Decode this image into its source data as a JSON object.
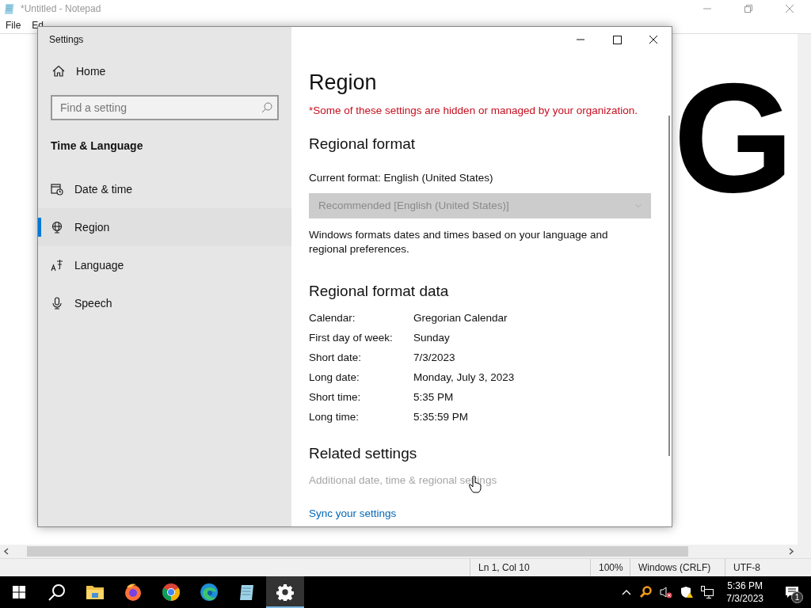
{
  "notepad": {
    "title": "*Untitled - Notepad",
    "menu": [
      "File",
      "Ed"
    ],
    "content": "G",
    "status": [
      "Ln 1, Col 10",
      "100%",
      "Windows (CRLF)",
      "UTF-8"
    ]
  },
  "settings": {
    "title": "Settings",
    "home": "Home",
    "search": {
      "placeholder": "Find a setting"
    },
    "section": "Time & Language",
    "nav": [
      {
        "kind": "calendar",
        "label": "Date & time",
        "selected": false
      },
      {
        "kind": "globe",
        "label": "Region",
        "selected": true
      },
      {
        "kind": "language",
        "label": "Language",
        "selected": false
      },
      {
        "kind": "mic",
        "label": "Speech",
        "selected": false
      }
    ],
    "page": {
      "title": "Region",
      "warning": "*Some of these settings are hidden or managed by your organization.",
      "format_heading": "Regional format",
      "current_format": "Current format: English (United States)",
      "dropdown": {
        "value": "Recommended [English (United States)]",
        "disabled": true
      },
      "description": "Windows formats dates and times based on your language and regional preferences.",
      "data_heading": "Regional format data",
      "data": [
        {
          "label": "Calendar:",
          "value": "Gregorian Calendar"
        },
        {
          "label": "First day of week:",
          "value": "Sunday"
        },
        {
          "label": "Short date:",
          "value": "7/3/2023"
        },
        {
          "label": "Long date:",
          "value": "Monday, July 3, 2023"
        },
        {
          "label": "Short time:",
          "value": "5:35 PM"
        },
        {
          "label": "Long time:",
          "value": "5:35:59 PM"
        }
      ],
      "related_heading": "Related settings",
      "links": [
        {
          "label": "Additional date, time & regional settings",
          "disabled": true
        },
        {
          "label": "Sync your settings",
          "disabled": false
        }
      ]
    }
  },
  "taskbar": {
    "apps": [
      {
        "kind": "search",
        "active": false
      },
      {
        "kind": "folder",
        "active": false
      },
      {
        "kind": "firefox",
        "active": false
      },
      {
        "kind": "chrome",
        "active": false
      },
      {
        "kind": "edge",
        "active": false
      },
      {
        "kind": "notepad",
        "active": false
      },
      {
        "kind": "gear",
        "active": true
      }
    ],
    "time": "5:36 PM",
    "date": "7/3/2023",
    "notifications": "1"
  }
}
